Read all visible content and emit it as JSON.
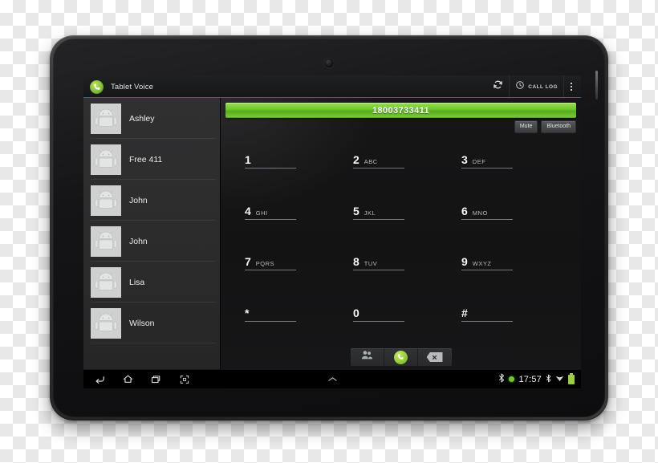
{
  "device": {
    "name": "android-tablet",
    "camera_label": "front-camera"
  },
  "actionbar": {
    "app_title": "Tablet Voice",
    "app_icon": "phone-icon",
    "refresh_icon": "refresh-icon",
    "calllog_icon": "clock-icon",
    "calllog_label": "CALL LOG",
    "overflow_icon": "overflow-menu-icon",
    "accent_color": "#2e6a84"
  },
  "contacts": {
    "items": [
      {
        "name": "Ashley",
        "avatar": "android-avatar-icon"
      },
      {
        "name": "Free 411",
        "avatar": "android-avatar-icon"
      },
      {
        "name": "John",
        "avatar": "android-avatar-icon"
      },
      {
        "name": "John",
        "avatar": "android-avatar-icon"
      },
      {
        "name": "Lisa",
        "avatar": "android-avatar-icon"
      },
      {
        "name": "Wilson",
        "avatar": "android-avatar-icon"
      }
    ]
  },
  "call": {
    "number": "18003733411",
    "bar_color": "#6ec82c",
    "mute_label": "Mute",
    "bluetooth_label": "Bluetooth"
  },
  "keypad": {
    "keys": [
      {
        "digit": "1",
        "letters": ""
      },
      {
        "digit": "2",
        "letters": "ABC"
      },
      {
        "digit": "3",
        "letters": "DEF"
      },
      {
        "digit": "4",
        "letters": "GHI"
      },
      {
        "digit": "5",
        "letters": "JKL"
      },
      {
        "digit": "6",
        "letters": "MNO"
      },
      {
        "digit": "7",
        "letters": "PQRS"
      },
      {
        "digit": "8",
        "letters": "TUV"
      },
      {
        "digit": "9",
        "letters": "WXYZ"
      },
      {
        "digit": "*",
        "letters": ""
      },
      {
        "digit": "0",
        "letters": ""
      },
      {
        "digit": "#",
        "letters": ""
      }
    ]
  },
  "dialer_toolbar": {
    "contacts_icon": "people-icon",
    "call_icon": "phone-call-icon",
    "delete_icon": "backspace-icon"
  },
  "systembar": {
    "back_icon": "back-icon",
    "home_icon": "home-icon",
    "recents_icon": "recent-apps-icon",
    "screenshot_icon": "screenshot-icon",
    "notification_handle_icon": "chevron-up-icon",
    "bluetooth_icon": "bluetooth-icon",
    "status_dot": "green-status-dot",
    "clock": "17:57",
    "bluetooth_icon_2": "bluetooth-icon",
    "wifi_icon": "wifi-icon",
    "battery_icon": "battery-icon"
  }
}
